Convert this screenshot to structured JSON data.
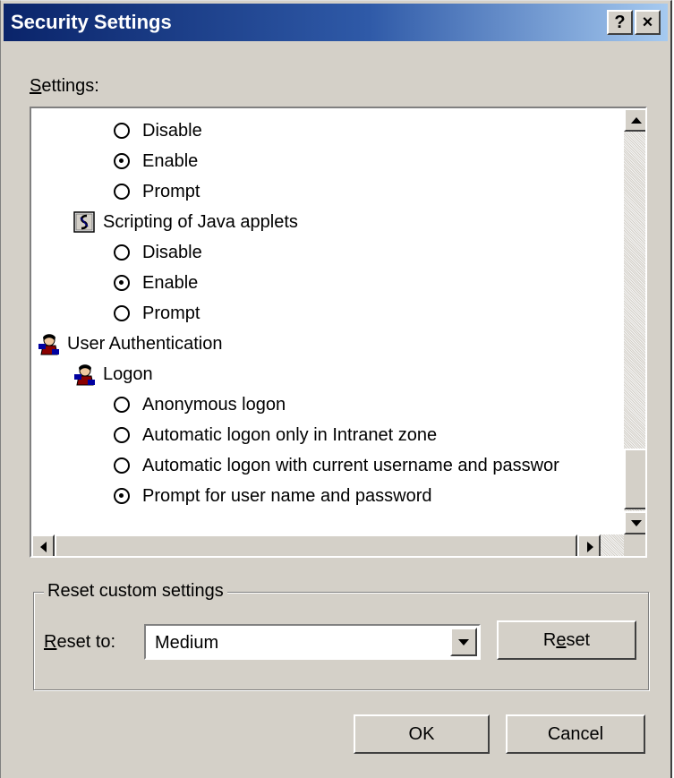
{
  "window": {
    "title": "Security Settings",
    "help_button": "?",
    "close_button": "×"
  },
  "settings": {
    "label_key": "S",
    "label_rest": "ettings:",
    "items": [
      {
        "kind": "radio",
        "label": "Disable",
        "checked": false
      },
      {
        "kind": "radio",
        "label": "Enable",
        "checked": true
      },
      {
        "kind": "radio",
        "label": "Prompt",
        "checked": false
      },
      {
        "kind": "category",
        "label": "Scripting of Java applets",
        "icon": "script-icon"
      },
      {
        "kind": "radio",
        "label": "Disable",
        "checked": false
      },
      {
        "kind": "radio",
        "label": "Enable",
        "checked": true
      },
      {
        "kind": "radio",
        "label": "Prompt",
        "checked": false
      },
      {
        "kind": "category",
        "label": "User Authentication",
        "icon": "user-authentication-icon"
      },
      {
        "kind": "category",
        "label": "Logon",
        "icon": "logon-icon"
      },
      {
        "kind": "radio",
        "label": "Anonymous logon",
        "checked": false
      },
      {
        "kind": "radio",
        "label": "Automatic logon only in Intranet zone",
        "checked": false
      },
      {
        "kind": "radio",
        "label": "Automatic logon with current username and passwor",
        "checked": false
      },
      {
        "kind": "radio",
        "label": "Prompt for user name and password",
        "checked": true
      }
    ]
  },
  "reset_group": {
    "legend": "Reset custom settings",
    "reset_to_key": "R",
    "reset_to_rest": "eset to:",
    "selected": "Medium",
    "reset_button_pre": "R",
    "reset_button_key": "e",
    "reset_button_post": "set"
  },
  "buttons": {
    "ok": "OK",
    "cancel": "Cancel"
  },
  "colors": {
    "titlebar_start": "#0a246a",
    "titlebar_end": "#a6caf0",
    "face": "#d4d0c8"
  }
}
